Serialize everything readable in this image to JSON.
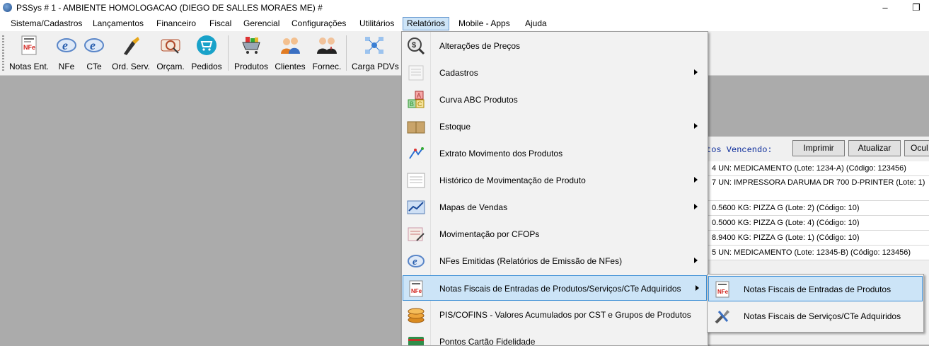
{
  "window": {
    "title": "PSSys # 1 - AMBIENTE HOMOLOGACAO (DIEGO DE SALLES MORAES ME) #",
    "minimize_icon": "minimize-icon",
    "restore_icon": "restore-icon"
  },
  "menubar": {
    "items": [
      "Sistema/Cadastros",
      "Lançamentos",
      "Financeiro",
      "Fiscal",
      "Gerencial",
      "Configurações",
      "Utilitários",
      "Relatórios",
      "Mobile - Apps",
      "Ajuda"
    ],
    "active": "Relatórios"
  },
  "toolbar": {
    "buttons": [
      {
        "label": "Notas Ent.",
        "icon": "nfe-document-icon"
      },
      {
        "label": "NFe",
        "icon": "nfe-e-icon"
      },
      {
        "label": "CTe",
        "icon": "cte-e-icon"
      },
      {
        "label": "Ord. Serv.",
        "icon": "service-order-icon"
      },
      {
        "label": "Orçam.",
        "icon": "budget-icon"
      },
      {
        "label": "Pedidos",
        "icon": "cart-circle-icon"
      },
      {
        "label": "Produtos",
        "icon": "shopping-cart-icon"
      },
      {
        "label": "Clientes",
        "icon": "clients-icon"
      },
      {
        "label": "Fornec.",
        "icon": "suppliers-icon"
      },
      {
        "label": "Carga PDVs",
        "icon": "network-icon"
      }
    ]
  },
  "panel": {
    "vencendo_label": "tos Vencendo:",
    "print_button": "Imprimir",
    "update_button": "Atualizar",
    "hide_button": "Ocul",
    "rows": [
      "4 UN: MEDICAMENTO (Lote: 1234-A) (Código: 123456)",
      "7 UN: IMPRESSORA DARUMA DR 700 D-PRINTER (Lote: 1)",
      "4)",
      "0.5600 KG: PIZZA G (Lote: 2) (Código: 10)",
      "0.5000 KG: PIZZA G (Lote: 4) (Código: 10)",
      "8.9400 KG: PIZZA G (Lote: 1) (Código: 10)",
      "5 UN: MEDICAMENTO (Lote: 12345-B) (Código: 123456)"
    ]
  },
  "dropdown": {
    "items": [
      {
        "label": "Alterações de Preços",
        "icon": "price-change-icon",
        "submenu": false
      },
      {
        "label": "Cadastros",
        "icon": "registry-icon",
        "submenu": true
      },
      {
        "label": "Curva ABC Produtos",
        "icon": "abc-blocks-icon",
        "submenu": false
      },
      {
        "label": "Estoque",
        "icon": "stock-boxes-icon",
        "submenu": true
      },
      {
        "label": "Extrato Movimento dos Produtos",
        "icon": "statement-icon",
        "submenu": false
      },
      {
        "label": "Histórico de Movimentação de Produto",
        "icon": "history-list-icon",
        "submenu": true
      },
      {
        "label": "Mapas de Vendas",
        "icon": "sales-map-icon",
        "submenu": true
      },
      {
        "label": "Movimentação por CFOPs",
        "icon": "cfop-icon",
        "submenu": false
      },
      {
        "label": "NFes Emitidas (Relatórios de Emissão de NFes)",
        "icon": "nfe-e-icon",
        "submenu": true
      },
      {
        "label": "Notas Fiscais de Entradas de Produtos/Serviços/CTe Adquiridos",
        "icon": "nfe-document-icon",
        "submenu": true,
        "highlighted": true
      },
      {
        "label": "PIS/COFINS - Valores Acumulados por CST e Grupos de Produtos",
        "icon": "coins-icon",
        "submenu": false
      },
      {
        "label": "Pontos Cartão Fidelidade",
        "icon": "loyalty-card-icon",
        "submenu": false
      }
    ]
  },
  "submenu": {
    "items": [
      {
        "label": "Notas Fiscais de Entradas de Produtos",
        "icon": "nfe-document-icon",
        "highlighted": true
      },
      {
        "label": "Notas Fiscais de Serviços/CTe Adquiridos",
        "icon": "tools-icon"
      }
    ]
  }
}
